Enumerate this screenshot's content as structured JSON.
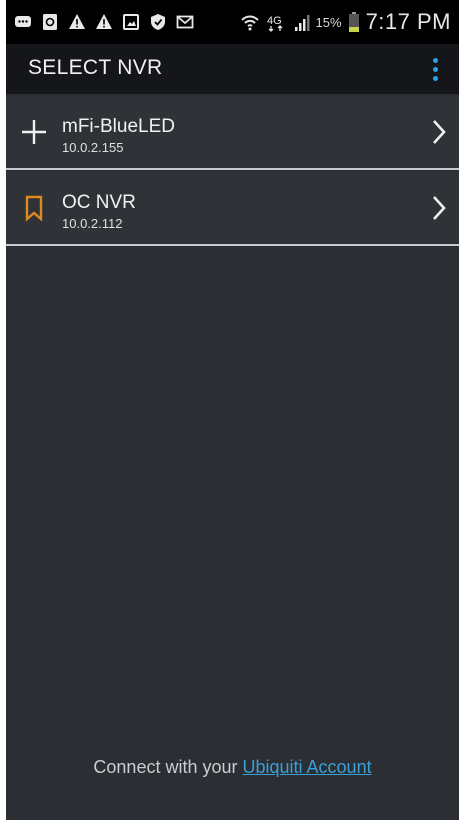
{
  "status_bar": {
    "icons": [
      "message-icon",
      "clipboard-icon",
      "warning-icon",
      "warning-icon",
      "image-icon",
      "shield-icon",
      "email-icon",
      "wifi-icon",
      "lte-icon",
      "signal-icon"
    ],
    "network_label": "4G",
    "battery_percent": "15%",
    "time": "7:17 PM"
  },
  "app_bar": {
    "title": "SELECT NVR",
    "overflow_icon": "more-vert-icon",
    "accent_color": "#29a3e8"
  },
  "nvr_list": [
    {
      "icon": "plus-icon",
      "name": "mFi-BlueLED",
      "ip": "10.0.2.155"
    },
    {
      "icon": "bookmark-icon",
      "icon_color": "#e08a1e",
      "name": "OC NVR",
      "ip": "10.0.2.112"
    }
  ],
  "footer": {
    "prefix": "Connect with your",
    "link_label": "Ubiquiti Account",
    "link_color": "#3aa0d8"
  }
}
